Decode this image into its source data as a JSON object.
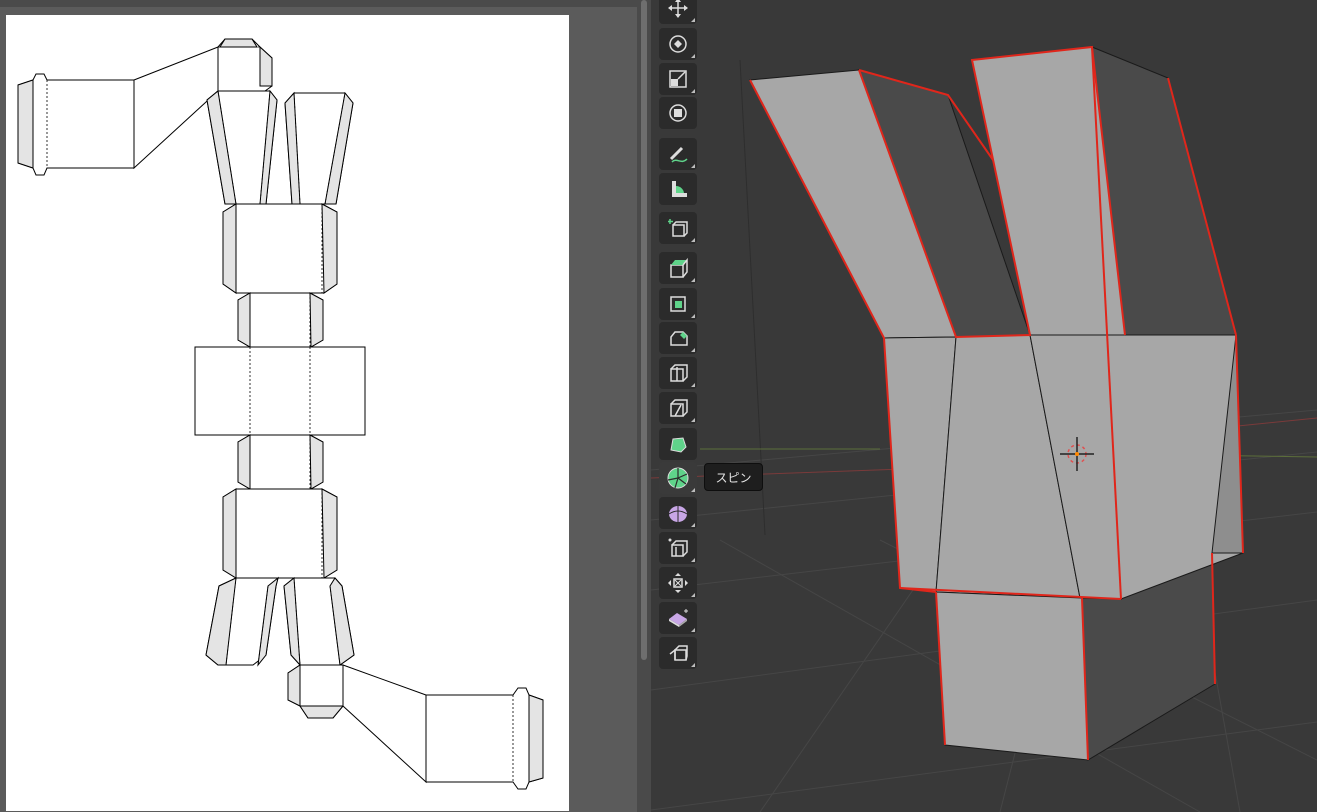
{
  "tooltip": {
    "text": "スピン"
  },
  "toolbar": {
    "tools": [
      "move-icon",
      "rotate-icon",
      "scale-icon",
      "transform-icon",
      "annotate-icon",
      "measure-icon",
      "add-cube-icon",
      "extrude-icon",
      "inset-faces-icon",
      "bevel-icon",
      "loop-cut-icon",
      "knife-icon",
      "poly-build-icon",
      "spin-icon",
      "smooth-icon",
      "edge-slide-icon",
      "shrink-fatten-icon",
      "shear-icon",
      "rip-region-icon"
    ]
  },
  "colors": {
    "paper": "#ffffff",
    "viewport_bg": "#393939",
    "selected_edge": "#e0261b",
    "face_light": "#a8a8a8",
    "face_dark": "#4a4a4a",
    "tool_accent": "#5fd38a"
  }
}
